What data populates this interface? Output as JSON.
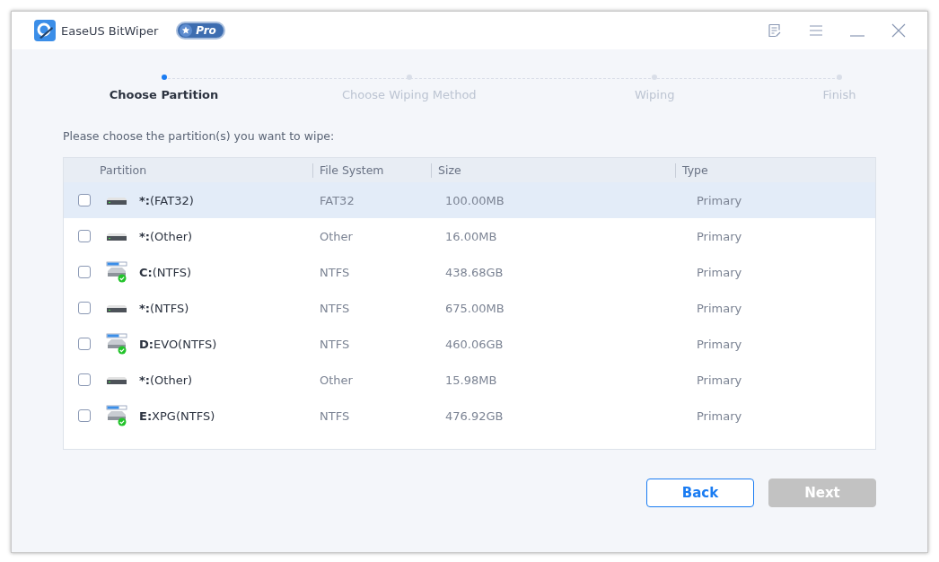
{
  "window": {
    "title": "EaseUS BitWiper",
    "badge": "Pro"
  },
  "steps": [
    {
      "label": "Choose Partition",
      "selected": true
    },
    {
      "label": "Choose Wiping Method",
      "selected": false
    },
    {
      "label": "Wiping",
      "selected": false
    },
    {
      "label": "Finish",
      "selected": false
    }
  ],
  "instruction": "Please choose the partition(s) you want to wipe:",
  "table": {
    "columns": [
      "Partition",
      "File System",
      "Size",
      "Type"
    ],
    "rows": [
      {
        "kind": "raw",
        "letter": "*:",
        "label": "(FAT32)",
        "file_system": "FAT32",
        "size": "100.00MB",
        "type": "Primary",
        "checked": false,
        "selected": true
      },
      {
        "kind": "raw",
        "letter": "*:",
        "label": "(Other)",
        "file_system": "Other",
        "size": "16.00MB",
        "type": "Primary",
        "checked": false,
        "selected": false
      },
      {
        "kind": "volume",
        "letter": "C:",
        "label": "(NTFS)",
        "file_system": "NTFS",
        "size": "438.68GB",
        "type": "Primary",
        "checked": false,
        "selected": false
      },
      {
        "kind": "raw",
        "letter": "*:",
        "label": "(NTFS)",
        "file_system": "NTFS",
        "size": "675.00MB",
        "type": "Primary",
        "checked": false,
        "selected": false
      },
      {
        "kind": "volume",
        "letter": "D:",
        "label": "EVO(NTFS)",
        "file_system": "NTFS",
        "size": "460.06GB",
        "type": "Primary",
        "checked": false,
        "selected": false
      },
      {
        "kind": "raw",
        "letter": "*:",
        "label": "(Other)",
        "file_system": "Other",
        "size": "15.98MB",
        "type": "Primary",
        "checked": false,
        "selected": false
      },
      {
        "kind": "volume",
        "letter": "E:",
        "label": "XPG(NTFS)",
        "file_system": "NTFS",
        "size": "476.92GB",
        "type": "Primary",
        "checked": false,
        "selected": false
      }
    ]
  },
  "buttons": [
    {
      "label": "Back",
      "disabled": false
    },
    {
      "label": "Next",
      "disabled": true
    }
  ]
}
